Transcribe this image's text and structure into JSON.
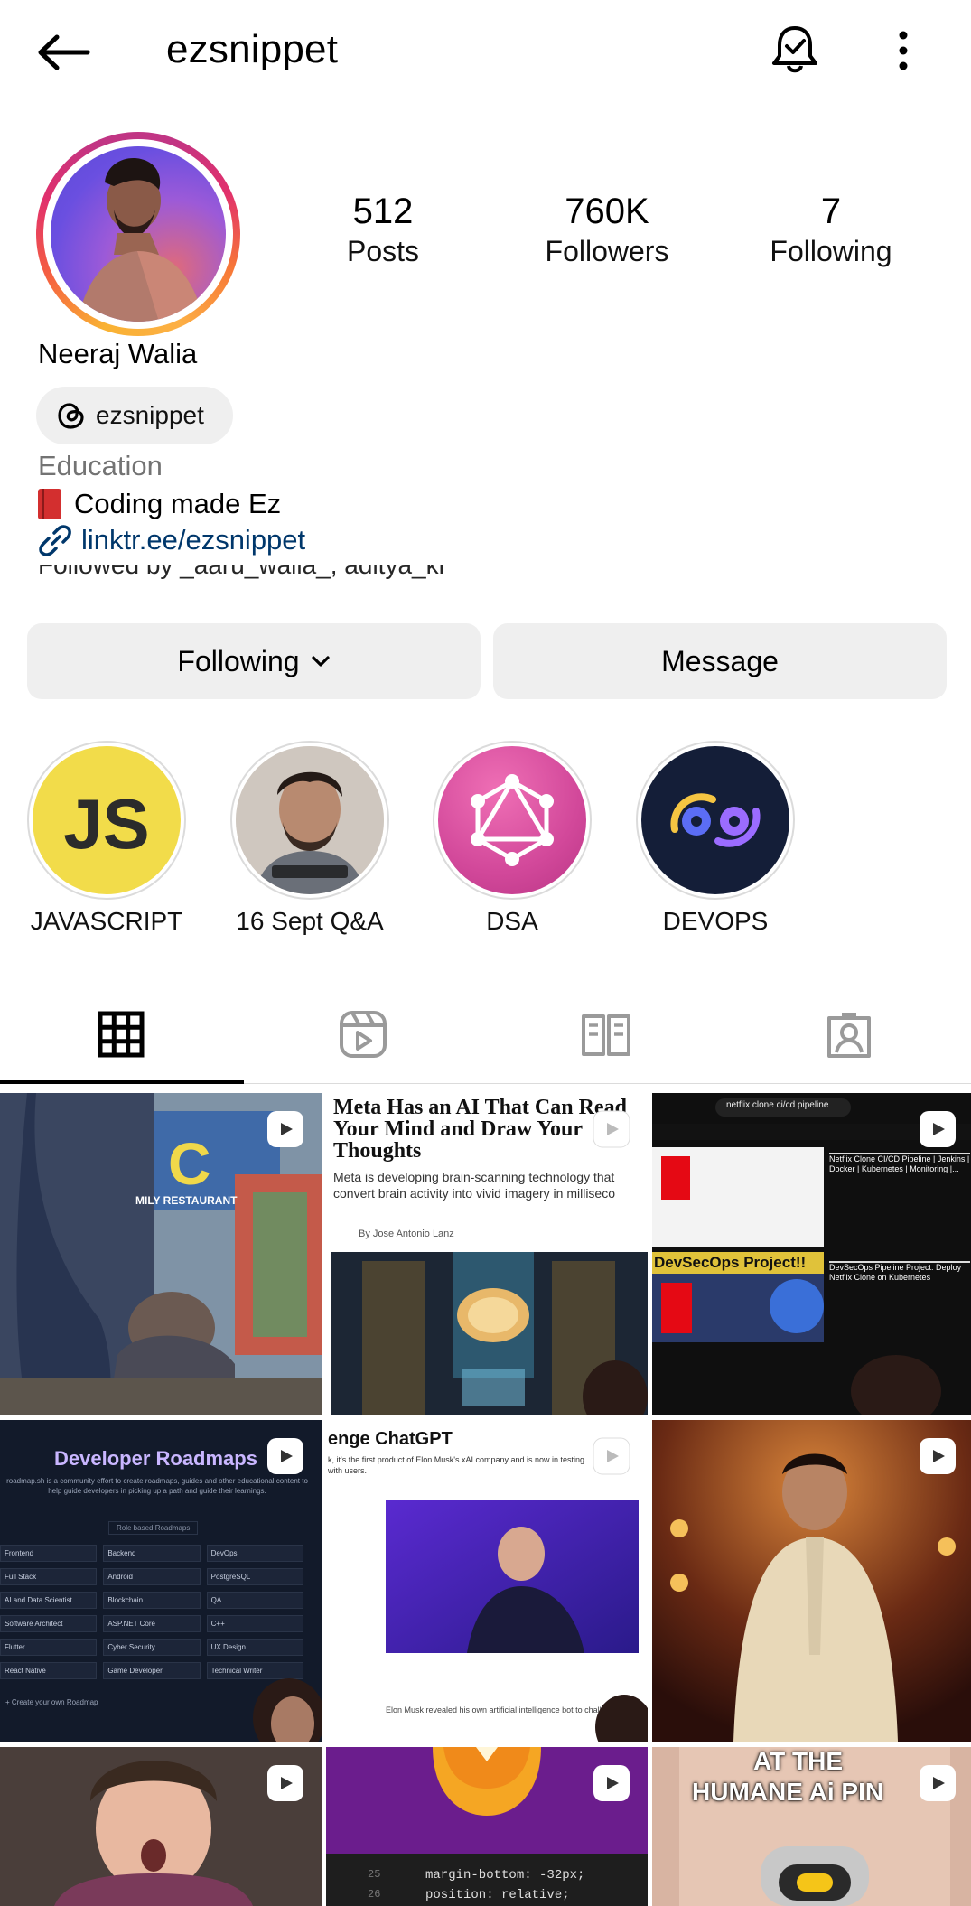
{
  "header": {
    "username": "ezsnippet"
  },
  "profile": {
    "display_name": "Neeraj Walia",
    "threads_handle": "ezsnippet",
    "category": "Education",
    "bio": "Coding made Ez",
    "link": "linktr.ee/ezsnippet",
    "followed_by": "Followed by _aaru_walia_, aditya_kr"
  },
  "stats": {
    "posts": {
      "value": "512",
      "label": "Posts"
    },
    "followers": {
      "value": "760K",
      "label": "Followers"
    },
    "following": {
      "value": "7",
      "label": "Following"
    }
  },
  "actions": {
    "following_label": "Following",
    "message_label": "Message"
  },
  "highlights": [
    {
      "label": "JAVASCRIPT",
      "icon_text": "JS"
    },
    {
      "label": "16 Sept Q&A"
    },
    {
      "label": "DSA"
    },
    {
      "label": "DEVOPS"
    }
  ],
  "tabs": [
    "grid-icon",
    "reels-icon",
    "guides-icon",
    "tagged-icon"
  ],
  "posts": [
    {
      "kind": "reel",
      "sign_text": "C",
      "sign_sub": "MILY RESTAURANT"
    },
    {
      "kind": "reel",
      "headline": "Meta Has an AI That Can Read Your Mind and Draw Your Thoughts",
      "subhead": "Meta is developing brain-scanning technology that convert brain activity into vivid imagery in milliseco",
      "byline": "By Jose Antonio Lanz"
    },
    {
      "kind": "reel",
      "search": "netflix clone ci/cd pipeline",
      "video1_title": "Netflix Clone CI/CD Pipeline | Jenkins | Docker | Kubernetes | Monitoring |...",
      "video2_title": "DevSecOps Pipeline Project: Deploy Netflix Clone on Kubernetes",
      "banner": "DevSecOps Project!!"
    },
    {
      "kind": "reel",
      "title": "Developer Roadmaps",
      "subtitle": "roadmap.sh is a community effort to create roadmaps, guides and other educational content to help guide developers in picking up a path and guide their learnings.",
      "section": "Role based Roadmaps",
      "items": [
        "Frontend",
        "Backend",
        "DevOps",
        "Full Stack",
        "Android",
        "PostgreSQL",
        "AI and Data Scientist",
        "Blockchain",
        "QA",
        "Software Architect",
        "ASP.NET Core",
        "C++",
        "Flutter",
        "Cyber Security",
        "UX Design",
        "React Native",
        "Game Developer",
        "Technical Writer"
      ],
      "create": "+ Create your own Roadmap"
    },
    {
      "kind": "reel",
      "headline": "enge ChatGPT",
      "subhead": "k, it's the first product of Elon Musk's xAI company and is now in testing with users.",
      "caption": "Elon Musk revealed his own artificial intelligence bot to challen"
    },
    {
      "kind": "reel"
    },
    {
      "kind": "reel"
    },
    {
      "kind": "reel",
      "code1": "margin-bottom: -32px;",
      "code2": "position: relative;",
      "line1": "25",
      "line2": "26"
    },
    {
      "kind": "reel",
      "caption_top": "AT THE",
      "caption_bottom": "HUMANE Ai PIN"
    }
  ],
  "colors": {
    "link": "#00376b",
    "pill_bg": "#efefef",
    "muted": "#737373"
  }
}
